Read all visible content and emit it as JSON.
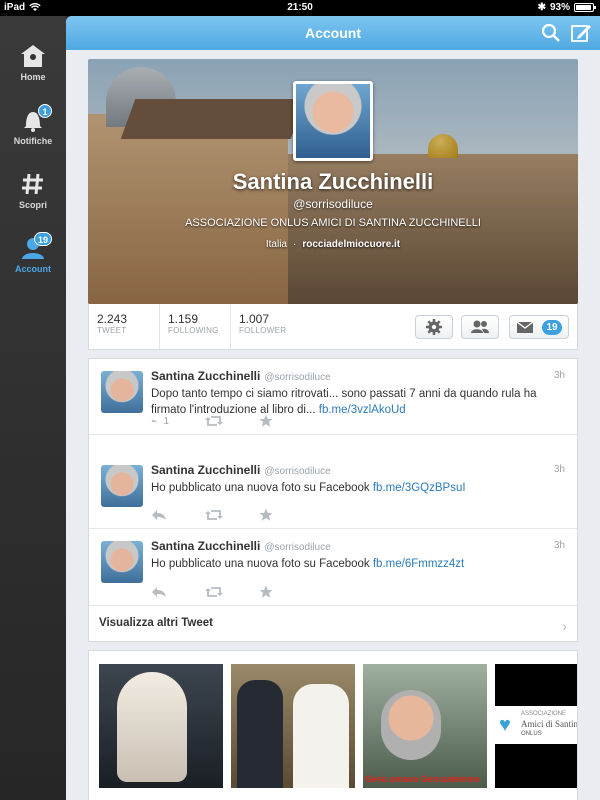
{
  "status": {
    "device": "iPad",
    "time": "21:50",
    "battery": "93%",
    "battery_level": 0.93
  },
  "rail": {
    "items": [
      {
        "label": "Home",
        "icon": "home-icon"
      },
      {
        "label": "Notifiche",
        "icon": "bell-icon",
        "badge": "1"
      },
      {
        "label": "Scopri",
        "icon": "hashtag-icon"
      },
      {
        "label": "Account",
        "icon": "user-icon",
        "badge": "19",
        "active": true
      }
    ]
  },
  "navbar": {
    "title": "Account"
  },
  "profile": {
    "name": "Santina Zucchinelli",
    "handle": "@sorrisodiluce",
    "bio": "ASSOCIAZIONE ONLUS AMICI DI SANTINA ZUCCHINELLI",
    "location": "Italia",
    "separator": "·",
    "website": "rocciadelmiocuore.it"
  },
  "stats": {
    "tweets": {
      "value": "2.243",
      "label": "TWEET"
    },
    "following": {
      "value": "1.159",
      "label": "FOLLOWING"
    },
    "followers": {
      "value": "1.007",
      "label": "FOLLOWER"
    },
    "messages_badge": "19"
  },
  "tweets": [
    {
      "name": "Santina Zucchinelli",
      "handle": "@sorrisodiluce",
      "time": "3h",
      "text": "Dopo tanto tempo ci siamo ritrovati... sono passati 7 anni da quando rula ha firmato l'introduzione al libro di...",
      "link": "fb.me/3vzlAkoUd",
      "reply_count": "1"
    },
    {
      "name": "Santina Zucchinelli",
      "handle": "@sorrisodiluce",
      "time": "3h",
      "text": "Ho pubblicato una nuova foto su Facebook",
      "link": "fb.me/3GQzBPsuI",
      "reply_count": ""
    },
    {
      "name": "Santina Zucchinelli",
      "handle": "@sorrisodiluce",
      "time": "3h",
      "text": "Ho pubblicato una nuova foto su Facebook",
      "link": "fb.me/6Fmmzz4zt",
      "reply_count": ""
    }
  ],
  "more_tweets": "Visualizza altri Tweet",
  "photos": {
    "caption3": "Gesù amava Gerusalemme",
    "logo_line1": "ASSOCIAZIONE",
    "logo_line2": "Amici di Santina",
    "logo_line3": "ONLUS"
  },
  "colors": {
    "accent": "#4fa9e2",
    "link": "#2b7bb9",
    "badge": "#3b9fe0"
  }
}
